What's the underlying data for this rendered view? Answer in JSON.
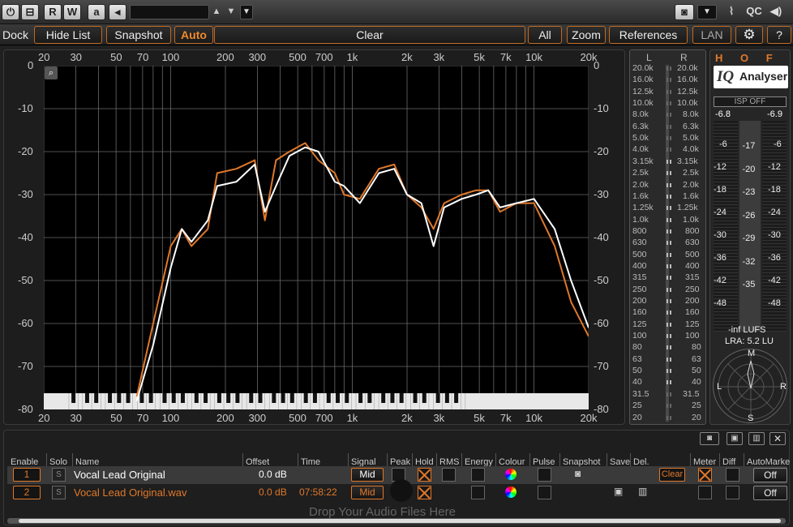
{
  "topbar": {
    "power": "⏻",
    "preset": "⊟",
    "read": "R",
    "write": "W",
    "a_btn": "a",
    "undo": "◂",
    "preset_name": "",
    "qc": "QC"
  },
  "navbar": {
    "dock": "Dock",
    "hide_list": "Hide List",
    "snapshot": "Snapshot",
    "auto": "Auto",
    "clear": "Clear",
    "all": "All",
    "zoom": "Zoom",
    "references": "References",
    "lan": "LAN",
    "help": "?"
  },
  "analyser": {
    "freq_labels": [
      "20",
      "30",
      "50",
      "70",
      "100",
      "200",
      "300",
      "500",
      "700",
      "1k",
      "2k",
      "3k",
      "5k",
      "7k",
      "10k",
      "20k"
    ],
    "db_labels": [
      "0",
      "-10",
      "-20",
      "-30",
      "-40",
      "-50",
      "-60",
      "-70",
      "-80"
    ],
    "chart_data": {
      "type": "line",
      "xlabel": "",
      "ylabel": "",
      "x_scale": "log",
      "xlim": [
        20,
        20000
      ],
      "ylim": [
        -80,
        0
      ],
      "grid": true,
      "series": [
        {
          "color": "#e0782a",
          "points": [
            [
              65,
              -77
            ],
            [
              80,
              -60
            ],
            [
              100,
              -42
            ],
            [
              115,
              -38
            ],
            [
              130,
              -42
            ],
            [
              160,
              -38
            ],
            [
              180,
              -25
            ],
            [
              230,
              -24
            ],
            [
              290,
              -22
            ],
            [
              330,
              -36
            ],
            [
              380,
              -22
            ],
            [
              450,
              -20
            ],
            [
              550,
              -18
            ],
            [
              650,
              -22
            ],
            [
              800,
              -25
            ],
            [
              900,
              -30
            ],
            [
              1100,
              -31
            ],
            [
              1400,
              -24
            ],
            [
              1700,
              -23
            ],
            [
              2000,
              -30
            ],
            [
              2400,
              -33
            ],
            [
              2800,
              -38
            ],
            [
              3200,
              -32
            ],
            [
              4000,
              -30
            ],
            [
              4800,
              -29
            ],
            [
              5600,
              -29
            ],
            [
              6500,
              -34
            ],
            [
              8000,
              -32
            ],
            [
              10000,
              -32
            ],
            [
              13000,
              -42
            ],
            [
              16000,
              -55
            ],
            [
              20000,
              -63
            ]
          ]
        },
        {
          "color": "#ffffff",
          "points": [
            [
              65,
              -78
            ],
            [
              80,
              -65
            ],
            [
              100,
              -47
            ],
            [
              115,
              -38
            ],
            [
              130,
              -41
            ],
            [
              160,
              -36
            ],
            [
              180,
              -28
            ],
            [
              230,
              -27
            ],
            [
              290,
              -23
            ],
            [
              330,
              -34
            ],
            [
              380,
              -28
            ],
            [
              450,
              -21
            ],
            [
              550,
              -19
            ],
            [
              650,
              -20
            ],
            [
              800,
              -27
            ],
            [
              900,
              -28
            ],
            [
              1100,
              -32
            ],
            [
              1400,
              -25
            ],
            [
              1700,
              -24
            ],
            [
              2000,
              -30
            ],
            [
              2400,
              -32
            ],
            [
              2800,
              -42
            ],
            [
              3200,
              -33
            ],
            [
              4000,
              -31
            ],
            [
              4800,
              -30
            ],
            [
              5600,
              -29
            ],
            [
              6500,
              -33
            ],
            [
              8000,
              -32
            ],
            [
              10000,
              -31
            ],
            [
              13000,
              -38
            ],
            [
              16000,
              -50
            ],
            [
              20000,
              -61
            ]
          ]
        }
      ]
    }
  },
  "meters": {
    "left": "L",
    "right": "R",
    "freqs": [
      "20.0k",
      "16.0k",
      "12.5k",
      "10.0k",
      "8.0k",
      "6.3k",
      "5.0k",
      "4.0k",
      "3.15k",
      "2.5k",
      "2.0k",
      "1.6k",
      "1.25k",
      "1.0k",
      "800",
      "630",
      "500",
      "400",
      "315",
      "250",
      "200",
      "160",
      "125",
      "100",
      "80",
      "63",
      "50",
      "40",
      "31.5",
      "25",
      "20"
    ]
  },
  "hofa": {
    "logo": "H O F A",
    "iq": "IQ",
    "analyser": "Analyser",
    "isp": "ISP OFF",
    "peak_l": "-6.8",
    "peak_r": "-6.9",
    "scale": [
      "-6",
      "-12",
      "-18",
      "-24",
      "-30",
      "-36",
      "-42",
      "-48"
    ],
    "lufs_scale": [
      "-17",
      "-20",
      "-23",
      "-26",
      "-29",
      "-32",
      "-35"
    ],
    "lufs": "-inf  LUFS",
    "lra": "LRA: 5.2 LU",
    "m": "M",
    "l": "L",
    "r": "R",
    "s": "S"
  },
  "list": {
    "headers": [
      "Enable",
      "Solo",
      "Name",
      "Offset",
      "Time",
      "Signal",
      "Peak",
      "Hold",
      "RMS",
      "Energy",
      "Colour",
      "Pulse",
      "Snapshot",
      "Save",
      "Del.",
      "Meter",
      "Diff",
      "AutoMarke"
    ],
    "rows": [
      {
        "num": "1",
        "solo": "S",
        "name": "Vocal Lead Original",
        "offset": "0.0 dB",
        "time": "",
        "signal": "Mid",
        "clear": "Clear",
        "auto": "Off"
      },
      {
        "num": "2",
        "solo": "S",
        "name": "Vocal Lead Original.wav",
        "offset": "0.0 dB",
        "time": "07:58:22",
        "signal": "Mid",
        "auto": "Off"
      }
    ],
    "drop": "Drop Your Audio Files Here"
  }
}
